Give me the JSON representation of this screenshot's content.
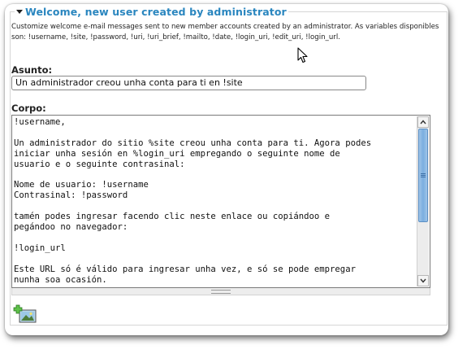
{
  "fieldset": {
    "legend": "Welcome, new user created by administrator",
    "description": "Customize welcome e-mail messages sent to new member accounts created by an administrator. As variables disponibles son: !username, !site, !password, !uri, !uri_brief, !mailto, !date, !login_uri, !edit_uri, !login_url."
  },
  "subject": {
    "label": "Asunto:",
    "value": "Un administrador creou unha conta para ti en !site"
  },
  "body": {
    "label": "Corpo:",
    "value": "!username,\n\nUn administrador do sitio %site creou unha conta para ti. Agora podes\niniciar unha sesión en %login_uri empregando o seguinte nome de\nusuario e o seguinte contrasinal:\n\nNome de usuario: !username\nContrasinal: !password\n\ntamén podes ingresar facendo clic neste enlace ou copiándoo e\npegándoo no navegador:\n\n!login_url\n\nEste URL só é válido para ingresar unha vez, e só se pode empregar\nnunha soa ocasión.",
    "scroll_position": 0.0
  },
  "icons": {
    "legend_toggle": "collapse-arrow-icon",
    "scroll_up": "chevron-up-icon",
    "scroll_down": "chevron-down-icon",
    "add_image": "add-image-icon",
    "cursor": "mouse-pointer-icon"
  },
  "colors": {
    "legend": "#2a86bf",
    "scroll_thumb": "#7aaee0"
  }
}
